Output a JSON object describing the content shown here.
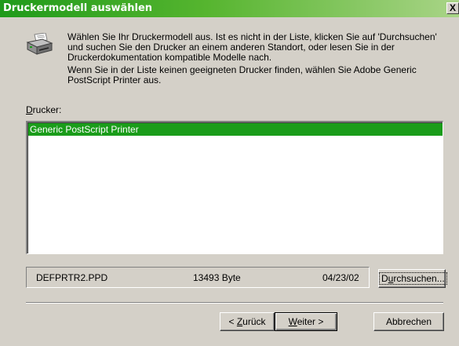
{
  "dialog": {
    "title": "Druckermodell auswählen",
    "close_label": "X",
    "intro_paragraph_1": "Wählen Sie Ihr Druckermodell aus. Ist es nicht in der Liste, klicken Sie auf 'Durchsuchen' und suchen Sie den Drucker an einem anderen Standort, oder lesen Sie in der Druckerdokumentation kompatible Modelle nach.",
    "intro_paragraph_2": "Wenn Sie in der Liste keinen geeigneten Drucker finden, wählen Sie Adobe Generic PostScript Printer aus.",
    "list_label_accel": "D",
    "list_label_rest": "rucker:",
    "printers": [
      {
        "name": "Generic PostScript Printer",
        "selected": true
      }
    ],
    "file_info": {
      "filename": "DEFPRTR2.PPD",
      "size": "13493 Byte",
      "date": "04/23/02"
    },
    "buttons": {
      "browse_pre": "D",
      "browse_accel": "u",
      "browse_post": "rchsuchen...",
      "back_pre": "< ",
      "back_accel": "Z",
      "back_post": "urück",
      "next_accel": "W",
      "next_post": "eiter >",
      "cancel": "Abbrechen"
    }
  },
  "icons": {
    "printer": "printer-icon"
  },
  "colors": {
    "titlebar_start": "#1f9a1a",
    "titlebar_end": "#a9d487",
    "selection": "#1a9c1a",
    "face": "#d4d0c8"
  }
}
